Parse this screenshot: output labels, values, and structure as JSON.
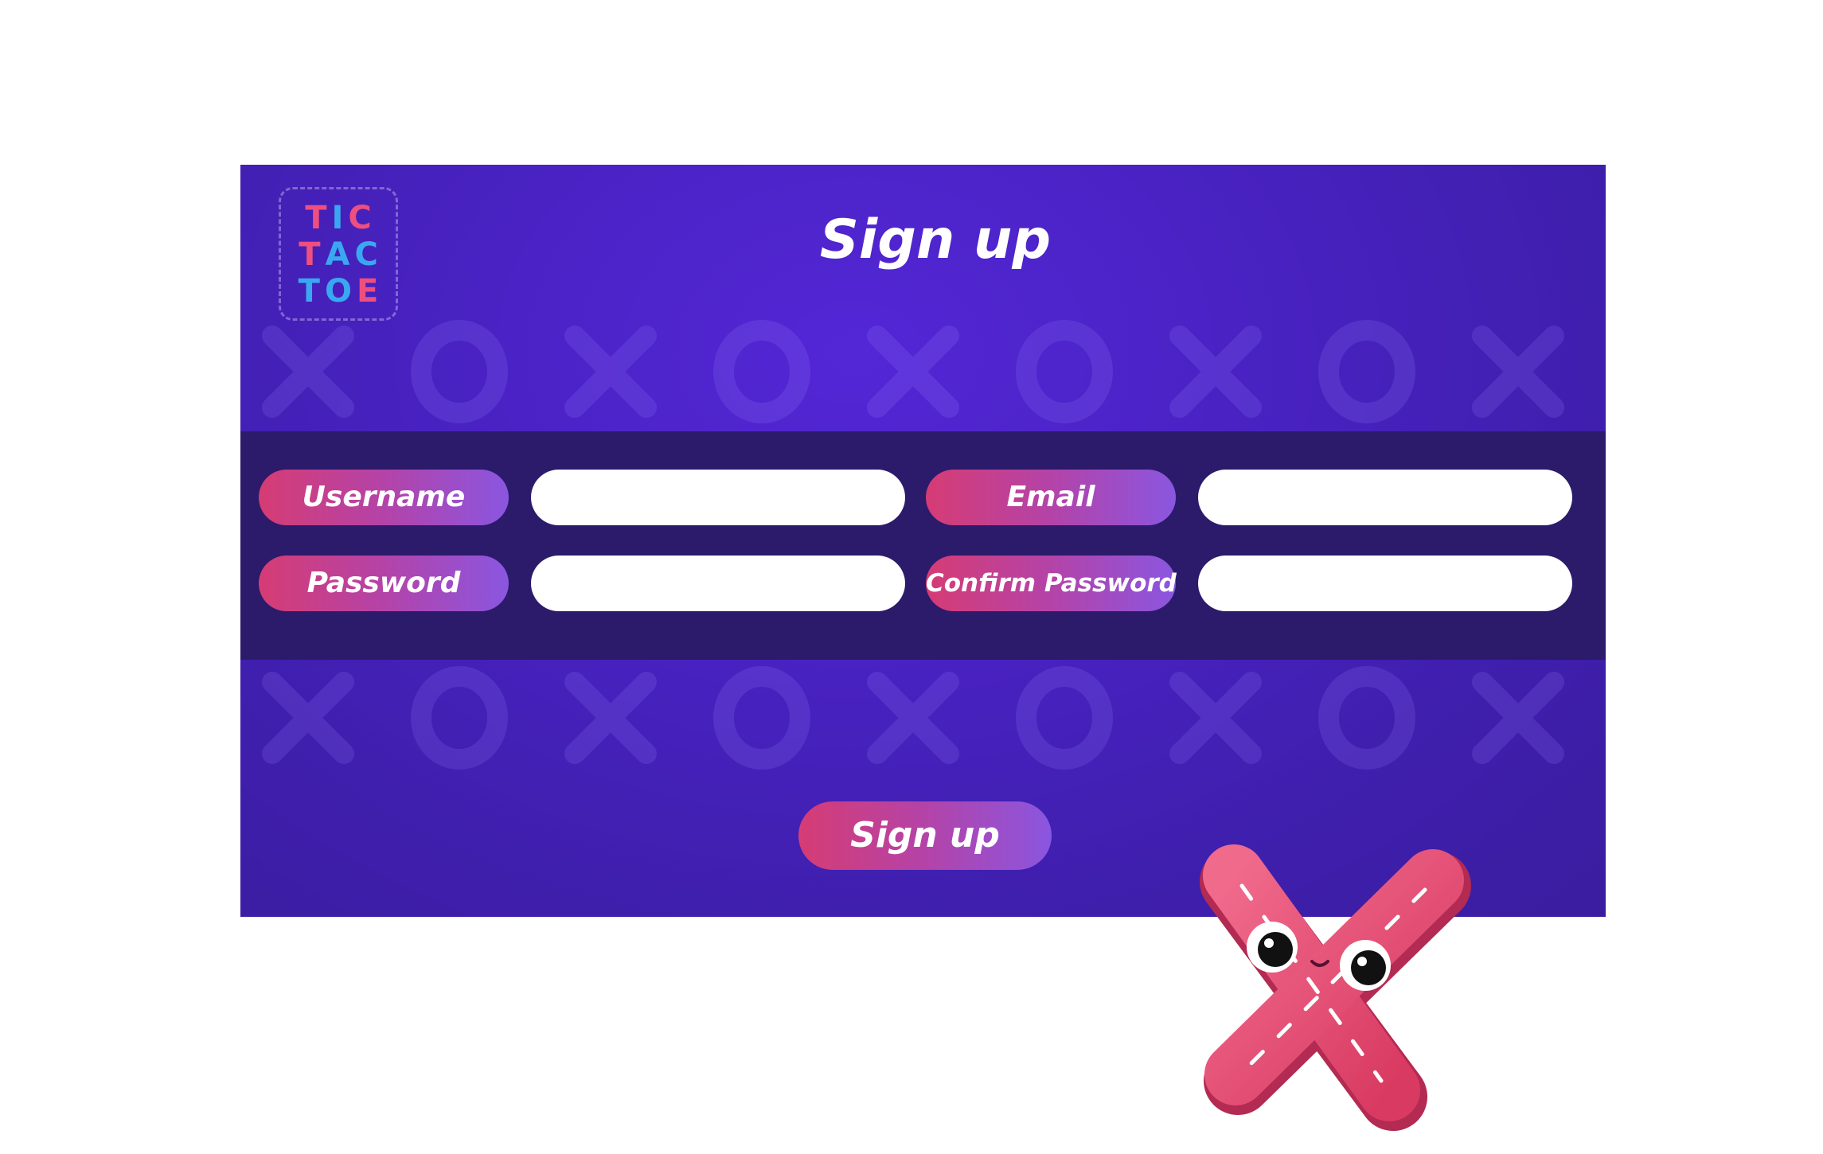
{
  "header": {
    "title": "Sign up",
    "logo_lines": [
      [
        "T",
        "I",
        "C"
      ],
      [
        "T",
        "A",
        "C"
      ],
      [
        "T",
        "O",
        "E"
      ]
    ]
  },
  "form": {
    "username_label": "Username",
    "email_label": "Email",
    "password_label": "Password",
    "confirm_password_label": "Confirm Password",
    "username_value": "",
    "email_value": "",
    "password_value": "",
    "confirm_password_value": ""
  },
  "actions": {
    "submit_label": "Sign up"
  },
  "colors": {
    "panel_bg": "#4a22c4",
    "band_bg": "#2c1a6b",
    "pill_start": "#d63c74",
    "pill_end": "#8a56e0",
    "logo_pink": "#ee4f7e",
    "logo_blue": "#3aa8f0",
    "mascot_pink": "#e8456e"
  },
  "icons": {
    "logo": "tic-tac-toe-logo",
    "mascot": "x-mascot-icon",
    "pattern": "x-o-pattern"
  }
}
